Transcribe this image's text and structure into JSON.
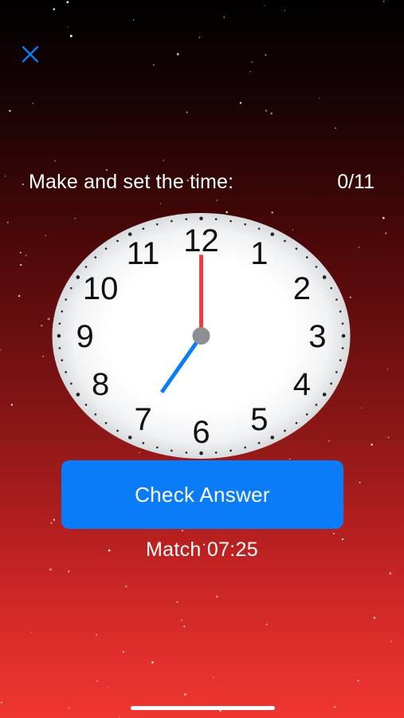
{
  "header": {
    "close_icon": "close-icon",
    "accent_color": "#0a7cf8"
  },
  "task": {
    "prompt": "Make and set the time:",
    "score": "0/11"
  },
  "clock": {
    "numbers": [
      "12",
      "1",
      "2",
      "3",
      "4",
      "5",
      "6",
      "7",
      "8",
      "9",
      "10",
      "11"
    ],
    "hour_hand_color": "#0a7cf8",
    "minute_hand_color": "#f33b3b",
    "hand_time": "07:00"
  },
  "actions": {
    "check_label": "Check Answer"
  },
  "target": {
    "match_text": "Match 07:25"
  }
}
